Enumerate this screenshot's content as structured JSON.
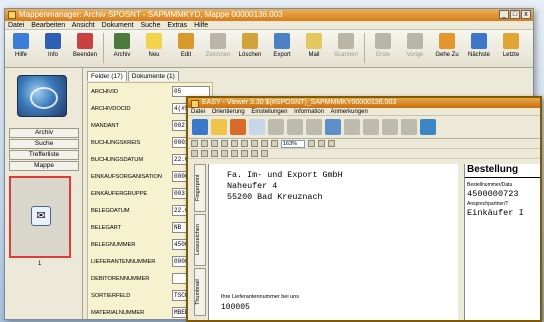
{
  "main_window": {
    "title": "Mappenmanager: Archiv SPOSNT - SAPMMMKYD, Mappe 00000136.003",
    "controls": [
      "_",
      "□",
      "x"
    ],
    "menu": [
      "Datei",
      "Bearbeiten",
      "Ansicht",
      "Dokument",
      "Suche",
      "Extras",
      "Hilfe"
    ],
    "toolbar": [
      {
        "label": "Hilfe",
        "icon": "help-icon",
        "color": "#3b7dd8",
        "disabled": false
      },
      {
        "label": "Info",
        "icon": "info-icon",
        "color": "#2c5fb5",
        "disabled": false
      },
      {
        "label": "Beenden",
        "icon": "exit-icon",
        "color": "#c84242",
        "disabled": false
      },
      {
        "label": "Archiv",
        "icon": "archive-icon",
        "color": "#4a7a3e",
        "disabled": false
      },
      {
        "label": "Neu",
        "icon": "new-icon",
        "color": "#f3d24c",
        "disabled": false
      },
      {
        "label": "Edit",
        "icon": "edit-icon",
        "color": "#d99a2b",
        "disabled": false
      },
      {
        "label": "Zeichnen",
        "icon": "draw-icon",
        "color": "#b9b6a8",
        "disabled": true
      },
      {
        "label": "Löschen",
        "icon": "delete-icon",
        "color": "#d1a33a",
        "disabled": false
      },
      {
        "label": "Export",
        "icon": "export-icon",
        "color": "#4c82c4",
        "disabled": false
      },
      {
        "label": "Mail",
        "icon": "mail-icon",
        "color": "#e5c760",
        "disabled": false
      },
      {
        "label": "Scannen",
        "icon": "scan-icon",
        "color": "#b9b6a8",
        "disabled": true
      },
      {
        "label": "Erste",
        "icon": "first-icon",
        "color": "#b9b6a8",
        "disabled": true
      },
      {
        "label": "Vorige",
        "icon": "previous-icon",
        "color": "#b9b6a8",
        "disabled": true
      },
      {
        "label": "Gehe Zu",
        "icon": "goto-icon",
        "color": "#e5962e",
        "disabled": false
      },
      {
        "label": "Nächste",
        "icon": "next-icon",
        "color": "#3c78c8",
        "disabled": false
      },
      {
        "label": "Letzte",
        "icon": "last-icon",
        "color": "#e0a532",
        "disabled": false
      }
    ],
    "sidebar": {
      "nav": [
        "Archiv",
        "Suche",
        "Trefferliste",
        "Mappe"
      ],
      "thumbnail_number": "1"
    },
    "tabs": [
      "Felder (17)",
      "Dokumente (1)"
    ],
    "fields": [
      {
        "label": "ARCHIVID",
        "value": "05"
      },
      {
        "label": "ARCHIVDOCID",
        "value": "4(#SPO"
      },
      {
        "label": "MANDANT",
        "value": "002"
      },
      {
        "label": "BUCHUNGSKREIS",
        "value": "0001"
      },
      {
        "label": "BUCHUNGSDATUM",
        "value": "22.01."
      },
      {
        "label": "EINKAUFSORGANISATION",
        "value": "0000"
      },
      {
        "label": "EINKÄUFERGRUPPE",
        "value": "003"
      },
      {
        "label": "BELEGDATUM",
        "value": "22.01."
      },
      {
        "label": "BELEGART",
        "value": "NB"
      },
      {
        "label": "BELEGNUMMER",
        "value": "450000"
      },
      {
        "label": "LIEFERANTENNUMMER",
        "value": "000010"
      },
      {
        "label": "DEBITORENNUMMER",
        "value": ""
      },
      {
        "label": "SORTIERFELD",
        "value": "TSCHIA"
      },
      {
        "label": "MATERIALNUMMER",
        "value": "MBEP-1"
      }
    ]
  },
  "viewer_window": {
    "title": "EASY - Viewer 3.30 $(#SPOSNT)_SAPMMMKY00000136.003",
    "menu": [
      "Datei",
      "Orientierung",
      "Einstellungen",
      "Information",
      "Anmerkungen"
    ],
    "zoom": "163%",
    "side_tabs": [
      "Fingerprint",
      "Lesezeichen",
      "Thumbnail"
    ],
    "address_lines": [
      "Fa. Im- und Export GmbH",
      "Naheufer 4",
      "55200 Bad Kreuznach"
    ],
    "ref_label": "Ihre Lieferantennummer bei uns",
    "ref_value": "100005",
    "order": {
      "title": "Bestellung",
      "number_label": "Bestellnummer/Datu",
      "number": "4500000723",
      "contact_label": "Ansprechpartner/T",
      "buyer": "Einkäufer I"
    }
  }
}
